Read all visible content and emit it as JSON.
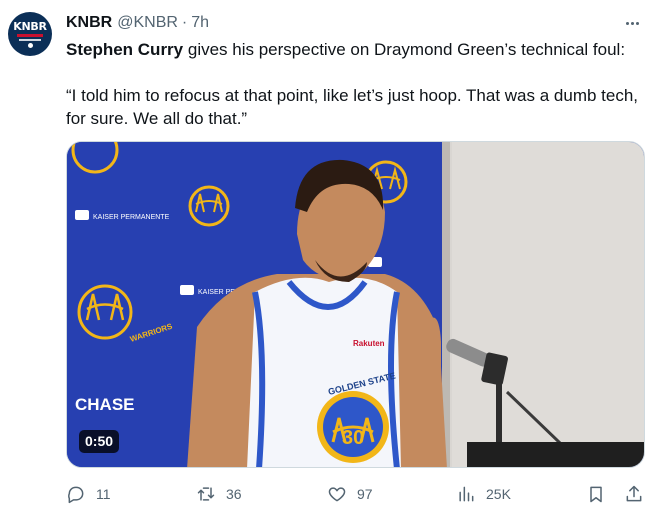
{
  "author": {
    "avatar_text": "KNBR",
    "name": "KNBR",
    "handle": "@KNBR",
    "separator": "·",
    "time": "7h"
  },
  "tweet": {
    "mention": "Stephen Curry",
    "text_rest": " gives his perspective on Draymond Green’s technical foul:",
    "quote": "“I told him to refocus at that point, like let’s just hoop. That was a dumb tech, for sure. We all do that.”"
  },
  "media": {
    "duration": "0:50",
    "jersey_line1": "GOLDEN STATE",
    "jersey_number": "30",
    "backdrop_logo_text": "WARRIORS",
    "sponsor_text": "KAISER PERMANENTE",
    "chase_text": "CHASE",
    "patch_text": "Rakuten"
  },
  "actions": {
    "reply_count": "11",
    "repost_count": "36",
    "like_count": "97",
    "views_count": "25K"
  },
  "colors": {
    "backdrop_blue": "#2a44b8",
    "warriors_gold": "#f2b618",
    "link_gray": "#536471"
  }
}
